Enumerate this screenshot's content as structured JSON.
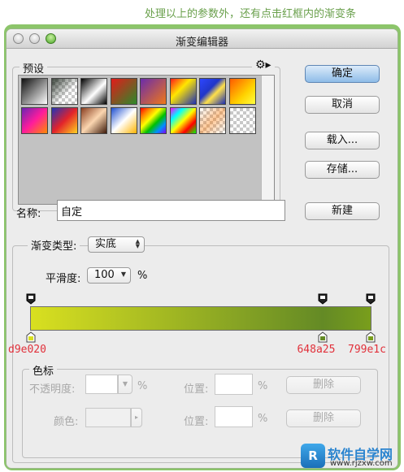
{
  "caption": "处理以上的参数外，还有点击红框内的渐变条",
  "window": {
    "title": "渐变编辑器"
  },
  "presets": {
    "legend": "预设",
    "gear_icon": "gear-icon",
    "swatches": [
      "linear-gradient(135deg,#111 0%,#fff 100%)",
      "checker-dark",
      "linear-gradient(135deg,#000 0%,#fff 55%,#000 100%)",
      "linear-gradient(135deg,#e31b1b 0%,#2a8a2a 100%)",
      "linear-gradient(135deg,#6a2cab 0%,#f07818 100%)",
      "linear-gradient(135deg,#ff1a1a 0%,#ffe600 40%,#1e2fb5 100%)",
      "linear-gradient(135deg,#2d46ff 0%,#2136c8 40%,#ffe14a 60%,#1a2cb4 100%)",
      "linear-gradient(135deg,#ff5a00 0%,#ffd200 60%,#ffff40 100%)",
      "linear-gradient(135deg,#6b24b3 0%,#ff1c9c 50%,#ff8c00 100%)",
      "linear-gradient(135deg,#2134b8 0%,#e2232b 50%,#ffd320 100%)",
      "linear-gradient(135deg,#8a3e20 0%,#fbd6b0 50%,#3d1a0a 100%)",
      "linear-gradient(135deg,#1e4fd0 0%,#ffffff 50%,#ffb400 100%)",
      "linear-gradient(135deg,#ff0000,#ff8800,#ffff00,#00c000,#0090ff,#8000ff)",
      "linear-gradient(135deg,#ff00ff,#00ffff,#ffff00,#ff0000,#00ff00)",
      "checker-red",
      "checker-light"
    ]
  },
  "buttons": {
    "ok": "确定",
    "cancel": "取消",
    "load": "载入...",
    "save": "存储...",
    "new": "新建",
    "delete1": "删除",
    "delete2": "删除"
  },
  "name": {
    "label": "名称:",
    "value": "自定"
  },
  "gradient": {
    "type_label": "渐变类型:",
    "type_value": "实底",
    "smooth_label": "平滑度:",
    "smooth_value": "100",
    "smooth_unit": "%",
    "bar_colors": [
      "#d9e020",
      "#648a25",
      "#799e1c"
    ],
    "stops": [
      {
        "hex": "d9e020",
        "color": "#d9e020",
        "position": 0
      },
      {
        "hex": "648a25",
        "color": "#648a25",
        "position": 86
      },
      {
        "hex": "799e1c",
        "color": "#799e1c",
        "position": 100
      }
    ],
    "opacity_stops": [
      0,
      86,
      100
    ]
  },
  "color_stop": {
    "legend": "色标",
    "opacity_label": "不透明度:",
    "opacity_unit": "%",
    "position_label1": "位置:",
    "position_unit1": "%",
    "color_label": "颜色:",
    "position_label2": "位置:",
    "position_unit2": "%"
  },
  "watermark": {
    "text": "软件自学网",
    "url": "www.rjzxw.com",
    "icon_text": "R"
  }
}
